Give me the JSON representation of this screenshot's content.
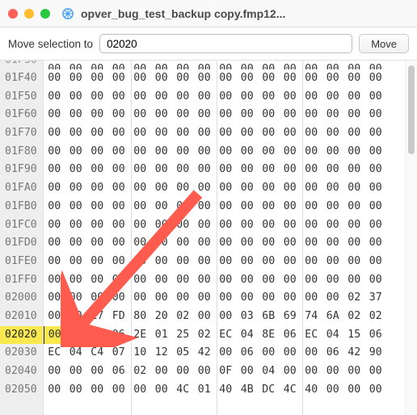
{
  "window": {
    "title": "opver_bug_test_backup copy.fmp12..."
  },
  "toolbar": {
    "label": "Move selection to",
    "input_value": "02020",
    "move_button": "Move"
  },
  "hex": {
    "first_partial_offset": "01F30",
    "offsets": [
      "01F40",
      "01F50",
      "01F60",
      "01F70",
      "01F80",
      "01F90",
      "01FA0",
      "01FB0",
      "01FC0",
      "01FD0",
      "01FE0",
      "01FF0",
      "02000",
      "02010",
      "02020",
      "02030",
      "02040",
      "02050"
    ],
    "highlight_offset": "02020",
    "highlight_cols": [
      0,
      1
    ],
    "caret_col": 0,
    "rows": [
      [
        "00",
        "00",
        "00",
        "00",
        "00",
        "00",
        "00",
        "00",
        "00",
        "00",
        "00",
        "00",
        "00",
        "00",
        "00",
        "00"
      ],
      [
        "00",
        "00",
        "00",
        "00",
        "00",
        "00",
        "00",
        "00",
        "00",
        "00",
        "00",
        "00",
        "00",
        "00",
        "00",
        "00"
      ],
      [
        "00",
        "00",
        "00",
        "00",
        "00",
        "00",
        "00",
        "00",
        "00",
        "00",
        "00",
        "00",
        "00",
        "00",
        "00",
        "00"
      ],
      [
        "00",
        "00",
        "00",
        "00",
        "00",
        "00",
        "00",
        "00",
        "00",
        "00",
        "00",
        "00",
        "00",
        "00",
        "00",
        "00"
      ],
      [
        "00",
        "00",
        "00",
        "00",
        "00",
        "00",
        "00",
        "00",
        "00",
        "00",
        "00",
        "00",
        "00",
        "00",
        "00",
        "00"
      ],
      [
        "00",
        "00",
        "00",
        "00",
        "00",
        "00",
        "00",
        "00",
        "00",
        "00",
        "00",
        "00",
        "00",
        "00",
        "00",
        "00"
      ],
      [
        "00",
        "00",
        "00",
        "00",
        "00",
        "00",
        "00",
        "00",
        "00",
        "00",
        "00",
        "00",
        "00",
        "00",
        "00",
        "00"
      ],
      [
        "00",
        "00",
        "00",
        "00",
        "00",
        "00",
        "00",
        "00",
        "00",
        "00",
        "00",
        "00",
        "00",
        "00",
        "00",
        "00"
      ],
      [
        "00",
        "00",
        "00",
        "00",
        "00",
        "00",
        "00",
        "00",
        "00",
        "00",
        "00",
        "00",
        "00",
        "00",
        "00",
        "00"
      ],
      [
        "00",
        "00",
        "00",
        "00",
        "00",
        "00",
        "00",
        "00",
        "00",
        "00",
        "00",
        "00",
        "00",
        "00",
        "00",
        "00"
      ],
      [
        "00",
        "00",
        "00",
        "00",
        "00",
        "00",
        "00",
        "00",
        "00",
        "00",
        "00",
        "00",
        "00",
        "00",
        "00",
        "00"
      ],
      [
        "00",
        "00",
        "00",
        "00",
        "00",
        "00",
        "00",
        "00",
        "00",
        "00",
        "00",
        "00",
        "00",
        "00",
        "00",
        "00"
      ],
      [
        "00",
        "00",
        "00",
        "00",
        "00",
        "00",
        "00",
        "00",
        "00",
        "00",
        "00",
        "00",
        "00",
        "00",
        "02",
        "37"
      ],
      [
        "00",
        "00",
        "17",
        "FD",
        "80",
        "20",
        "02",
        "00",
        "00",
        "03",
        "6B",
        "69",
        "74",
        "6A",
        "02",
        "02"
      ],
      [
        "00",
        "00",
        "06",
        "06",
        "2E",
        "01",
        "25",
        "02",
        "EC",
        "04",
        "8E",
        "06",
        "EC",
        "04",
        "15",
        "06"
      ],
      [
        "EC",
        "04",
        "C4",
        "07",
        "10",
        "12",
        "05",
        "42",
        "00",
        "06",
        "00",
        "00",
        "00",
        "06",
        "42",
        "90"
      ],
      [
        "00",
        "00",
        "00",
        "06",
        "02",
        "00",
        "00",
        "00",
        "0F",
        "00",
        "04",
        "00",
        "00",
        "00",
        "00",
        "00"
      ],
      [
        "00",
        "00",
        "00",
        "00",
        "00",
        "00",
        "4C",
        "01",
        "40",
        "4B",
        "DC",
        "4C",
        "40",
        "00",
        "00",
        "00"
      ]
    ]
  }
}
